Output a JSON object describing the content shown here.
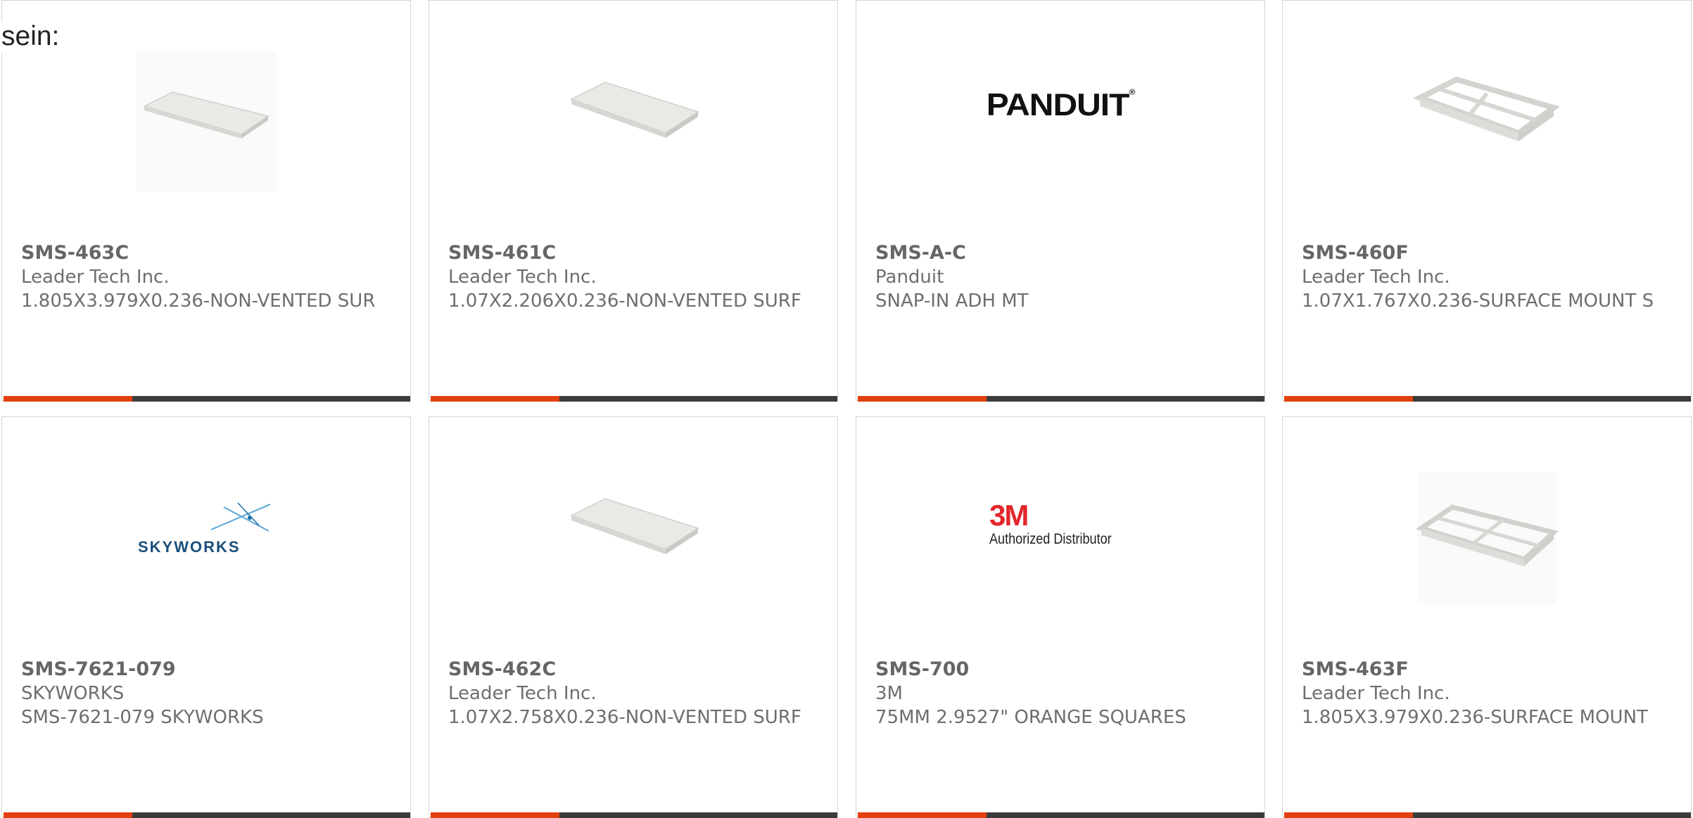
{
  "intro_text": "sein:",
  "colors": {
    "accent": "#e2400e",
    "bar_dark": "#3c3c3c",
    "border": "#d4d4d4",
    "text": "#6e6e6e"
  },
  "products": [
    {
      "part_number": "SMS-463C",
      "manufacturer": "Leader Tech Inc.",
      "description": "1.805X3.979X0.236-NON-VENTED SUR",
      "image": "flat-shield-cover"
    },
    {
      "part_number": "SMS-461C",
      "manufacturer": "Leader Tech Inc.",
      "description": "1.07X2.206X0.236-NON-VENTED SURF",
      "image": "flat-shield-cover"
    },
    {
      "part_number": "SMS-A-C",
      "manufacturer": "Panduit",
      "description": "SNAP-IN ADH MT",
      "image": "panduit-logo",
      "logo_text": "PANDUIT"
    },
    {
      "part_number": "SMS-460F",
      "manufacturer": "Leader Tech Inc.",
      "description": "1.07X1.767X0.236-SURFACE MOUNT S",
      "image": "shield-frame"
    },
    {
      "part_number": "SMS-7621-079",
      "manufacturer": "SKYWORKS",
      "description": "SMS-7621-079 SKYWORKS",
      "image": "skyworks-logo",
      "logo_text": "SKYWORKS"
    },
    {
      "part_number": "SMS-462C",
      "manufacturer": "Leader Tech Inc.",
      "description": "1.07X2.758X0.236-NON-VENTED SURF",
      "image": "flat-shield-cover"
    },
    {
      "part_number": "SMS-700",
      "manufacturer": "3M",
      "description": "75MM 2.9527\" ORANGE SQUARES",
      "image": "3m-logo",
      "logo_text": "3M",
      "logo_subtext": "Authorized Distributor"
    },
    {
      "part_number": "SMS-463F",
      "manufacturer": "Leader Tech Inc.",
      "description": "1.805X3.979X0.236-SURFACE MOUNT",
      "image": "shield-frame"
    }
  ]
}
